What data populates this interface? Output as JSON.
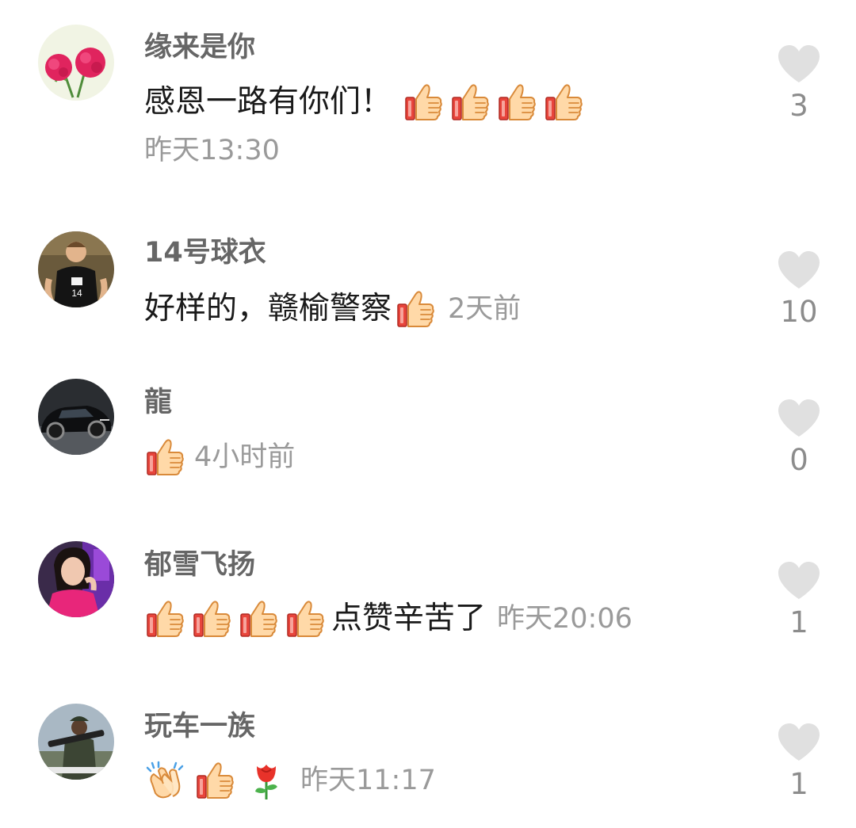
{
  "comments": [
    {
      "username": "缘来是你",
      "avatar_icon": "carnation-flowers-avatar",
      "text": "感恩一路有你们！",
      "emojis_after": [
        "thumbs-up",
        "thumbs-up",
        "thumbs-up",
        "thumbs-up"
      ],
      "time": "昨天13:30",
      "likes": "3"
    },
    {
      "username": "14号球衣",
      "avatar_icon": "basketball-player-avatar",
      "text": "好样的，赣榆警察",
      "emojis_after": [
        "thumbs-up"
      ],
      "time": "2天前",
      "likes": "10"
    },
    {
      "username": "龍",
      "avatar_icon": "black-sports-car-avatar",
      "emojis_before": [
        "thumbs-up"
      ],
      "time": "4小时前",
      "likes": "0"
    },
    {
      "username": "郁雪飞扬",
      "avatar_icon": "woman-portrait-avatar",
      "emojis_before": [
        "thumbs-up",
        "thumbs-up",
        "thumbs-up",
        "thumbs-up"
      ],
      "text": "点赞辛苦了",
      "time": "昨天20:06",
      "likes": "1"
    },
    {
      "username": "玩车一族",
      "avatar_icon": "soldier-avatar",
      "emojis_before": [
        "clapping-hands",
        "thumbs-up",
        "rose"
      ],
      "time": "昨天11:17",
      "likes": "1"
    }
  ],
  "colors": {
    "username": "#666666",
    "body_text": "#1a1a1a",
    "timestamp": "#9a9a9a",
    "like_heart": "#e0e0e0",
    "like_count": "#8c8c8c"
  }
}
